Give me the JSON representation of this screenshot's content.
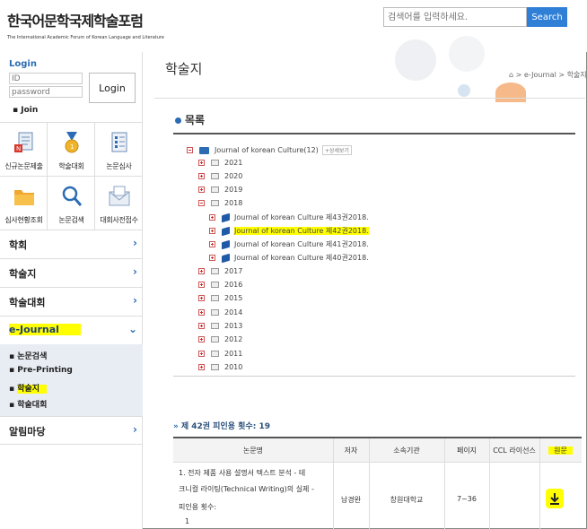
{
  "header": {
    "logo_title": "한국어문학국제학술포럼",
    "logo_subtitle": "The International Academic Forum of Korean Language and Literature",
    "search_placeholder": "검색어를 입력하세요.",
    "search_button": "Search"
  },
  "login": {
    "title": "Login",
    "id_placeholder": "ID",
    "password_placeholder": "password",
    "button": "Login",
    "join": "Join"
  },
  "quick_menu": [
    {
      "label": "신규논문제출",
      "icon": "new-paper-icon"
    },
    {
      "label": "학술대회",
      "icon": "medal-icon"
    },
    {
      "label": "논문심사",
      "icon": "checklist-icon"
    },
    {
      "label": "심사현황조회",
      "icon": "folder-icon"
    },
    {
      "label": "논문검색",
      "icon": "magnifier-icon"
    },
    {
      "label": "대회사전접수",
      "icon": "envelope-icon"
    }
  ],
  "menu": [
    {
      "label": "학회"
    },
    {
      "label": "학술지"
    },
    {
      "label": "학술대회"
    },
    {
      "label": "e-Journal"
    },
    {
      "label": "알림마당"
    }
  ],
  "sub_menu": [
    "논문검색",
    "Pre-Printing",
    "학술지",
    "학술대회"
  ],
  "page": {
    "title": "학술지",
    "breadcrumb": "⌂ > e-Journal > 학술지",
    "toc_title": "목록"
  },
  "tree": {
    "root": "Journal of korean Culture(12)",
    "detail_tag": "+상세보기",
    "years_top": [
      "2021",
      "2020",
      "2019",
      "2018"
    ],
    "issues_2018": [
      "Journal of korean Culture 제43권2018.",
      "Journal of korean Culture 제42권2018.",
      "Journal of korean Culture 제41권2018.",
      "Journal of korean Culture 제40권2018."
    ],
    "years_bottom": [
      "2017",
      "2016",
      "2015",
      "2014",
      "2013",
      "2012",
      "2011",
      "2010"
    ]
  },
  "count_line": "제 42권 피인용 횟수: 19",
  "table": {
    "headers": [
      "논문명",
      "저자",
      "소속기관",
      "페이지",
      "CCL 라이선스",
      "원문"
    ],
    "row": {
      "title_line1": "1. 전자 제품 사용 설명서 텍스트 분석 - 테",
      "title_line2": "크니컬 라이팅(Technical Writing)의 실제 -",
      "title_line3": "피인용 횟수:",
      "title_line4": "1",
      "author": "남경완",
      "affiliation": "창원대학교",
      "pages": "7~36",
      "ccl": ""
    }
  },
  "colors": {
    "accent": "#2b6cb3",
    "highlight": "#ffff00",
    "search_button": "#2f7fd6"
  }
}
